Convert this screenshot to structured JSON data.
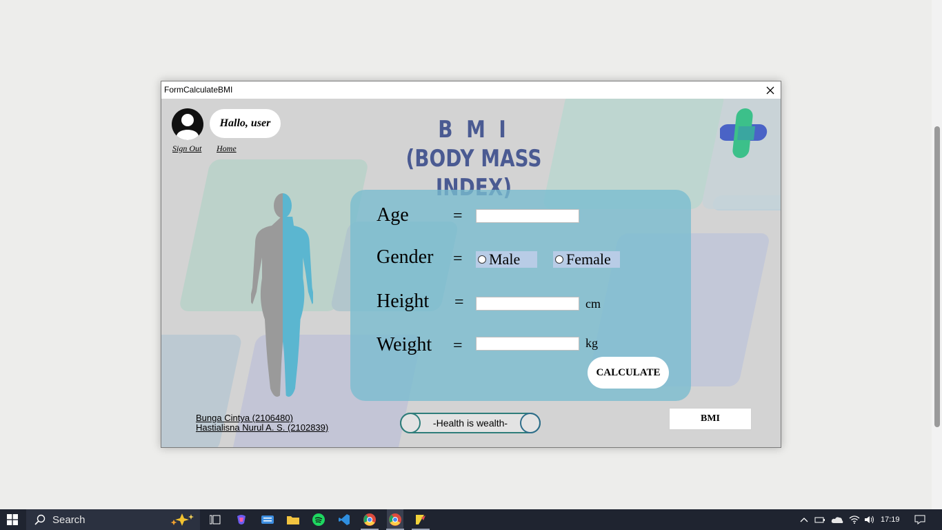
{
  "window": {
    "title": "FormCalculateBMI"
  },
  "header": {
    "greeting": "Hallo, user",
    "sign_out": "Sign Out",
    "home": "Home",
    "title_line1": "B M I",
    "title_line2": "(BODY MASS INDEX)"
  },
  "form": {
    "age_label": "Age",
    "gender_label": "Gender",
    "height_label": "Height",
    "weight_label": "Weight",
    "equals": "=",
    "age_value": "",
    "height_value": "",
    "weight_value": "",
    "gender_options": [
      "Male",
      "Female"
    ],
    "height_unit": "cm",
    "weight_unit": "kg",
    "calculate_label": "CALCULATE"
  },
  "footer": {
    "author1": "Bunga Cintya (2106480)",
    "author2": "Hastialisna Nurul A. S. (2102839)",
    "motto": "-Health is wealth-",
    "bmi_button": "BMI"
  },
  "taskbar": {
    "search_label": "Search",
    "time": "17:19"
  },
  "colors": {
    "title_blue": "#4a5a92",
    "panel": "#78bdcf",
    "logo_green": "#3cc08a",
    "logo_blue": "#4a63c6"
  }
}
